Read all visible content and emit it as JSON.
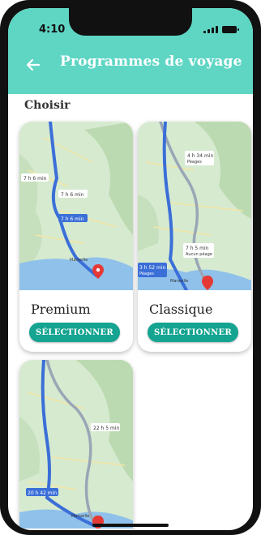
{
  "status_bar": {
    "time": "4:10"
  },
  "header": {
    "title": "Programmes de voyage",
    "back_icon": "arrow-left-icon"
  },
  "section": {
    "title": "Choisir"
  },
  "cards": [
    {
      "title": "Premium",
      "button_label": "SÉLECTIONNER",
      "map_labels": [
        "7 h 6 min",
        "7 h 6 min",
        "7 h 6 min"
      ],
      "map_city": "Marseille"
    },
    {
      "title": "Classique",
      "button_label": "SÉLECTIONNER",
      "map_labels": [
        "4 h 34 min",
        "Péages",
        "7 h 5 min",
        "Aucun péage",
        "3 h 52 min",
        "Péages"
      ],
      "map_city": "Marseille"
    },
    {
      "map_labels": [
        "22 h 5 min",
        "20 h 42 min"
      ],
      "map_city": "Marseille"
    }
  ],
  "colors": {
    "header": "#5fd6c4",
    "button": "#14a491",
    "route_primary": "#3b6fd8",
    "route_alt": "#9aa6b5",
    "map_land": "#d6ead0",
    "map_water": "#8fc1ea"
  }
}
